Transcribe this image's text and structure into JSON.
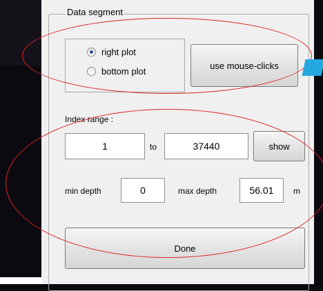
{
  "data_segment": {
    "title": "Data segment",
    "radio_right_plot": "right plot",
    "radio_bottom_plot": "bottom plot",
    "selected": "right plot",
    "mouse_button": "use mouse-clicks"
  },
  "index_range": {
    "label": "Index range :",
    "from_value": "1",
    "to_label": "to",
    "to_value": "37440",
    "show_button": "show"
  },
  "depth": {
    "min_label": "min depth",
    "min_value": "0",
    "max_label": "max depth",
    "max_value": "56.01",
    "unit": "m"
  },
  "done_button": "Done",
  "colors": {
    "panel_bg": "#f0f0f0",
    "annotation_red": "#e02020",
    "marker_cyan": "#25a8e0",
    "background_dark": "#0b0a10"
  }
}
